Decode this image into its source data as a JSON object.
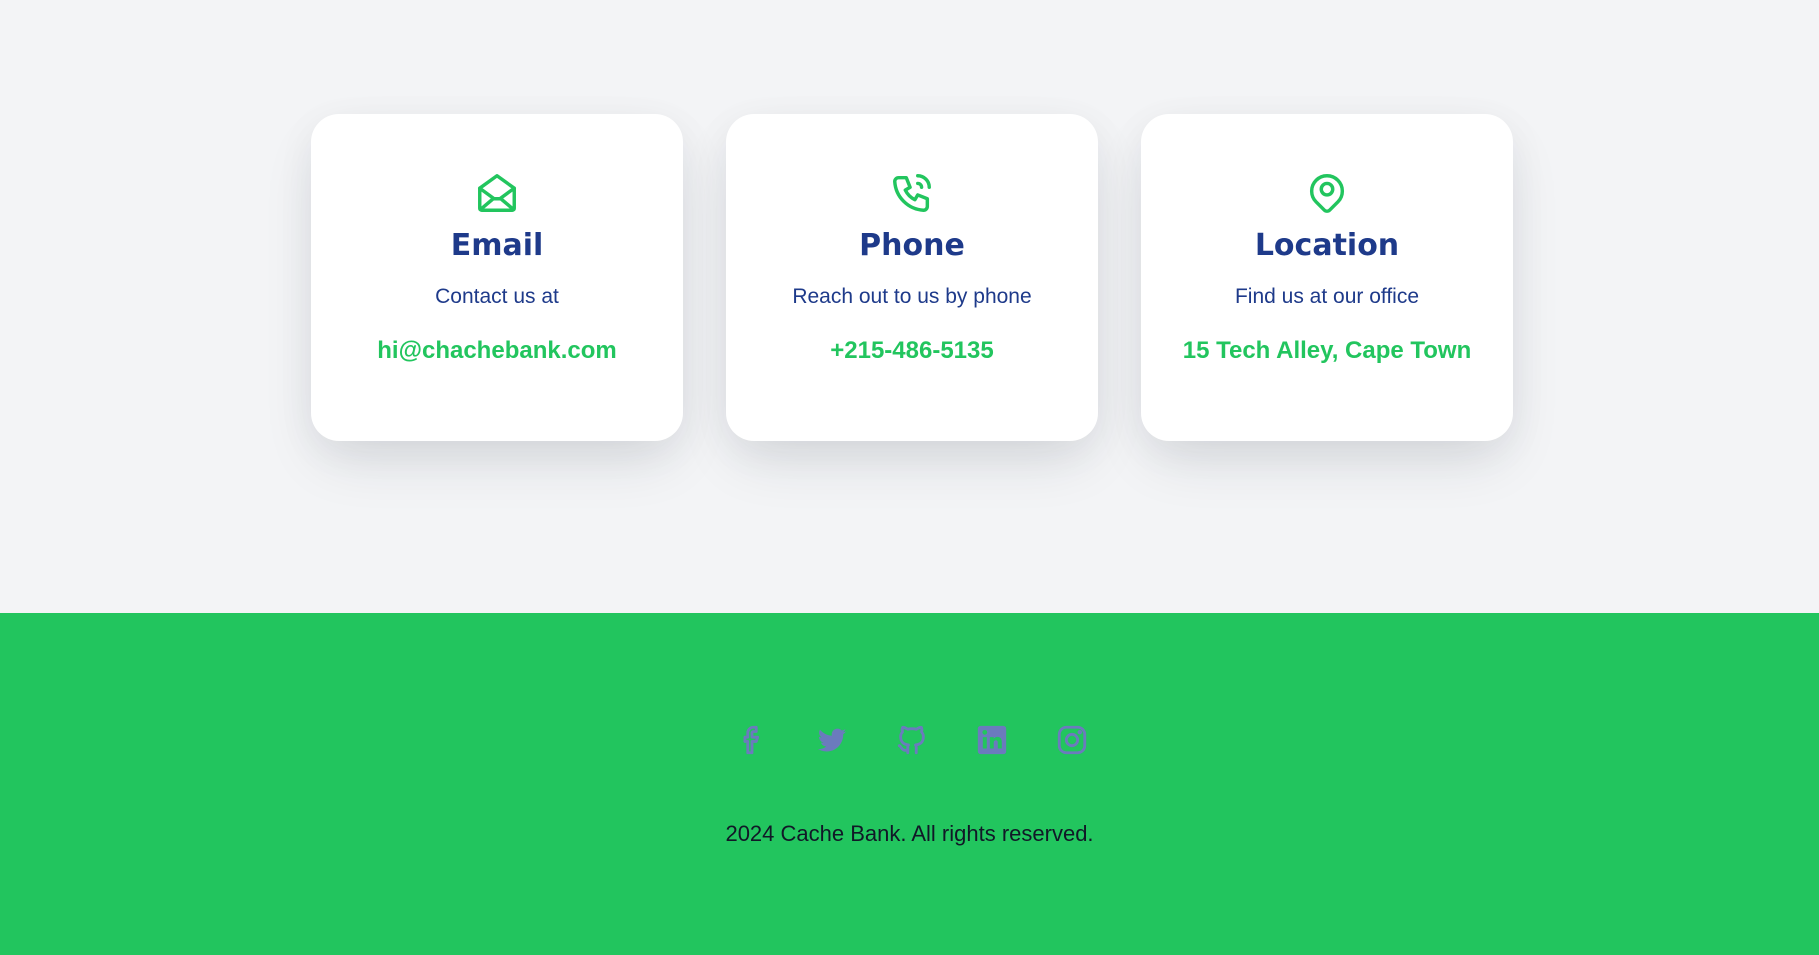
{
  "contact": {
    "cards": [
      {
        "icon": "envelope-open-icon",
        "title": "Email",
        "description": "Contact us at",
        "value": "hi@chachebank.com"
      },
      {
        "icon": "phone-ringing-icon",
        "title": "Phone",
        "description": "Reach out to us by phone",
        "value": "+215-486-5135"
      },
      {
        "icon": "map-pin-icon",
        "title": "Location",
        "description": "Find us at our office",
        "value": "15 Tech Alley, Cape Town"
      }
    ]
  },
  "footer": {
    "social": [
      {
        "icon": "facebook-icon"
      },
      {
        "icon": "twitter-icon"
      },
      {
        "icon": "github-icon"
      },
      {
        "icon": "linkedin-icon"
      },
      {
        "icon": "instagram-icon"
      }
    ],
    "copyright": "2024 Cache Bank. All rights reserved."
  },
  "colors": {
    "accent_green": "#22c55e",
    "heading_navy": "#1e3a8a",
    "social_icon": "#6b7bbd",
    "page_bg": "#f3f4f6"
  }
}
